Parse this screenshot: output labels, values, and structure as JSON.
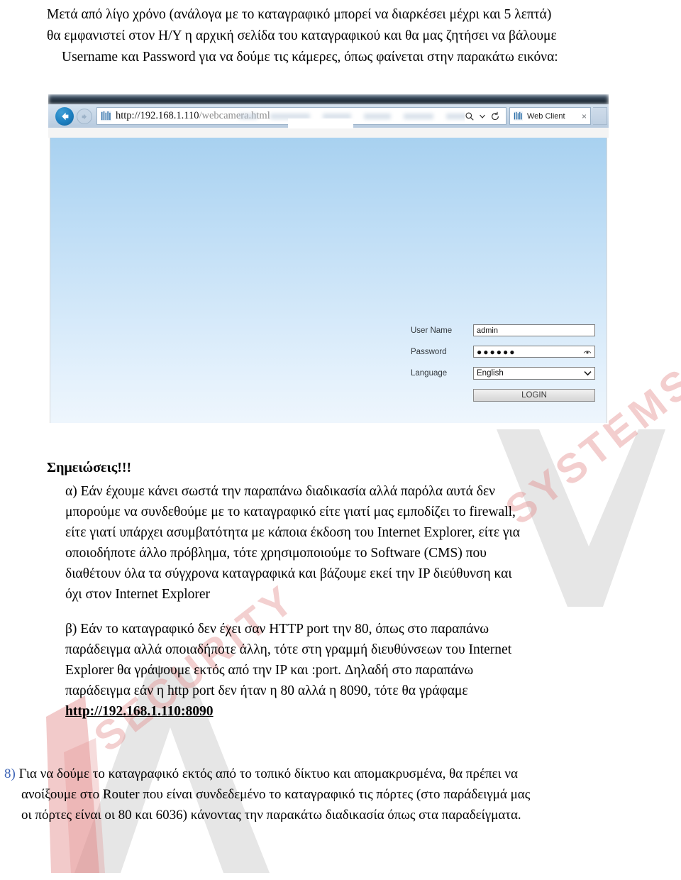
{
  "intro": {
    "line1": "Μετά από λίγο χρόνο (ανάλογα με το καταγραφικό μπορεί να διαρκέσει μέχρι και 5 λεπτά)",
    "line2": "θα εμφανιστεί στον Η/Υ η αρχική σελίδα του καταγραφικού και θα μας ζητήσει να βάλουμε",
    "line3": "Username και Password για να δούμε τις κάμερες, όπως φαίνεται στην παρακάτω εικόνα:"
  },
  "browser": {
    "back_title": "Back",
    "forward_title": "Forward",
    "address_host": "http://192.168.1.110",
    "address_path": "/webcamera.html",
    "search_icon": "search-icon",
    "refresh_icon": "refresh-icon",
    "tab_label": "Web Client",
    "tab_close": "×"
  },
  "login": {
    "username_label": "User Name",
    "username_value": "admin",
    "password_label": "Password",
    "password_value": "●●●●●●",
    "language_label": "Language",
    "language_value": "English",
    "login_button": "LOGIN"
  },
  "notes": {
    "heading": "Σημειώσεις!!!",
    "a": {
      "line1": "α) Εάν έχουμε κάνει σωστά την παραπάνω διαδικασία αλλά παρόλα αυτά δεν",
      "line2": "μπορούμε να συνδεθούμε με το καταγραφικό είτε γιατί μας εμποδίζει το firewall,",
      "line3": "είτε γιατί υπάρχει ασυμβατότητα με κάποια έκδοση του Internet Explorer, είτε για",
      "line4": "οποιοδήποτε άλλο πρόβλημα, τότε χρησιμοποιούμε το Software (CMS) που",
      "line5": "διαθέτουν όλα τα σύγχρονα καταγραφικά και βάζουμε εκεί την IP διεύθυνση και",
      "line6": "όχι στον Internet Explorer"
    },
    "b": {
      "line1": "β) Εάν το καταγραφικό δεν έχει σαν HTTP port την 80, όπως στο παραπάνω",
      "line2": "παράδειγμα αλλά οποιαδήποτε άλλη, τότε στη γραμμή διευθύνσεων του Internet",
      "line3": "Explorer θα γράψουμε εκτός από την IP και :port. Δηλαδή στο παραπάνω",
      "line4": "παράδειγμα εάν η http port δεν ήταν η 80 αλλά η 8090, τότε θα γράφαμε",
      "url": "http://192.168.1.110:8090"
    }
  },
  "item8": {
    "number": "8)",
    "line1": " Για να δούμε το καταγραφικό εκτός από το τοπικό δίκτυο και απομακρυσμένα, θα πρέπει να",
    "line2": "ανοίξουμε στο Router που είναι συνδεδεμένο το καταγραφικό τις πόρτες (στο παράδειγμά μας",
    "line3": "οι πόρτες είναι οι 80 και 6036) κάνοντας την παρακάτω διαδικασία όπως στα παραδείγματα."
  },
  "watermark": {
    "text_upper": "SYSTEMS",
    "text_lower": "SECURITY",
    "gray": "#e4e4e4",
    "pink": "#e28a8a"
  }
}
